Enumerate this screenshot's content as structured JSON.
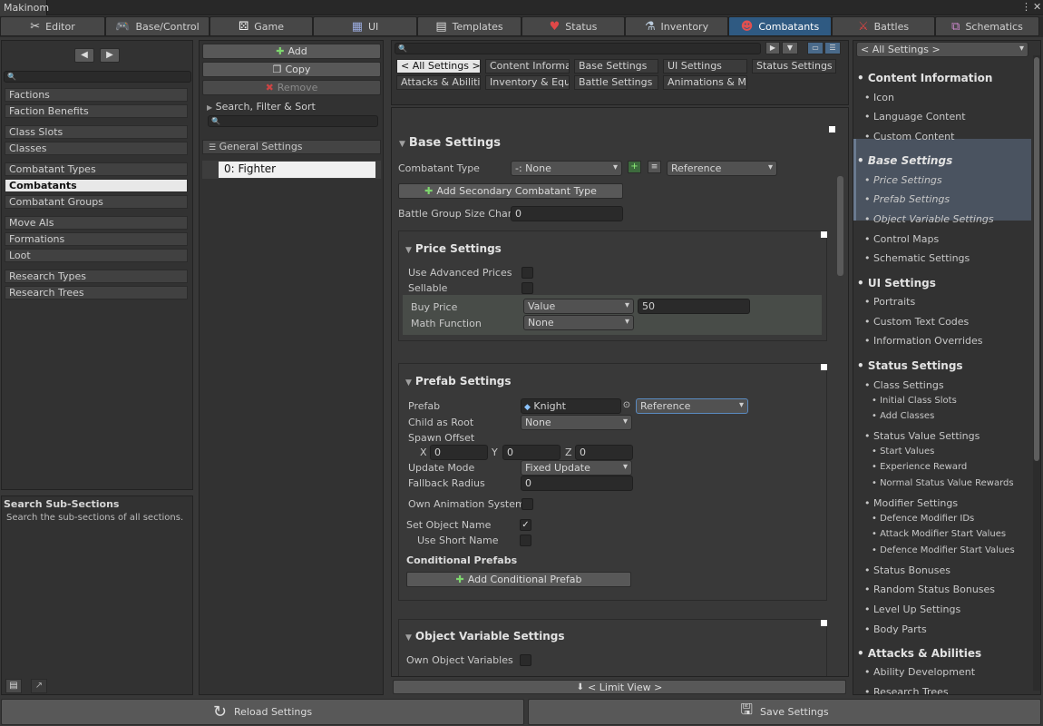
{
  "window": {
    "title": "Makinom"
  },
  "tabs": [
    {
      "label": "Editor",
      "icon": "tools-icon"
    },
    {
      "label": "Base/Control",
      "icon": "gamepad-icon"
    },
    {
      "label": "Game",
      "icon": "dice-icon"
    },
    {
      "label": "UI",
      "icon": "ui-window-icon"
    },
    {
      "label": "Templates",
      "icon": "document-icon"
    },
    {
      "label": "Status",
      "icon": "heart-icon"
    },
    {
      "label": "Inventory",
      "icon": "potion-icon"
    },
    {
      "label": "Combatants",
      "icon": "combatant-icon"
    },
    {
      "label": "Battles",
      "icon": "crossed-swords-icon"
    },
    {
      "label": "Schematics",
      "icon": "schematic-icon"
    }
  ],
  "active_tab": "Combatants",
  "left_nav": {
    "groups": [
      [
        "Factions",
        "Faction Benefits"
      ],
      [
        "Class Slots",
        "Classes"
      ],
      [
        "Combatant Types",
        "Combatants",
        "Combatant Groups"
      ],
      [
        "Move AIs",
        "Formations",
        "Loot"
      ],
      [
        "Research Types",
        "Research Trees"
      ]
    ],
    "active": "Combatants",
    "help_title": "Search Sub-Sections",
    "help_text": "Search the sub-sections of all sections."
  },
  "list_panel": {
    "add_label": "Add",
    "copy_label": "Copy",
    "remove_label": "Remove",
    "search_label": "Search, Filter & Sort",
    "general_settings_label": "General Settings",
    "items": [
      "0: Fighter"
    ]
  },
  "chips": {
    "row1": [
      "< All Settings >",
      "Content Informatic",
      "Base Settings",
      "UI Settings",
      "Status Settings"
    ],
    "row2": [
      "Attacks & Abilities",
      "Inventory & Equipr",
      "Battle Settings",
      "Animations & Mov"
    ]
  },
  "base_settings": {
    "title": "Base Settings",
    "combatant_type_label": "Combatant Type",
    "combatant_type_value": "-: None",
    "combatant_type_mode": "Reference",
    "add_secondary_label": "Add Secondary Combatant Type",
    "battle_group_label": "Battle Group Size Change",
    "battle_group_value": "0"
  },
  "price_settings": {
    "title": "Price Settings",
    "use_advanced_label": "Use Advanced Prices",
    "sellable_label": "Sellable",
    "buy_price_label": "Buy Price",
    "buy_price_type": "Value",
    "buy_price_value": "50",
    "math_function_label": "Math Function",
    "math_function_value": "None"
  },
  "prefab_settings": {
    "title": "Prefab Settings",
    "prefab_label": "Prefab",
    "prefab_value": "Knight",
    "prefab_mode": "Reference",
    "child_as_root_label": "Child as Root",
    "child_as_root_value": "None",
    "spawn_offset_label": "Spawn Offset",
    "x_label": "X",
    "x_value": "0",
    "y_label": "Y",
    "y_value": "0",
    "z_label": "Z",
    "z_value": "0",
    "update_mode_label": "Update Mode",
    "update_mode_value": "Fixed Update",
    "fallback_radius_label": "Fallback Radius",
    "fallback_radius_value": "0",
    "own_animation_label": "Own Animation System",
    "set_object_name_label": "Set Object Name",
    "use_short_name_label": "Use Short Name",
    "conditional_prefabs_label": "Conditional Prefabs",
    "add_conditional_label": "Add Conditional Prefab"
  },
  "object_variable_settings": {
    "title": "Object Variable Settings",
    "own_object_variables_label": "Own Object Variables"
  },
  "limit_view_label": "< Limit View >",
  "right_tree": {
    "dropdown": "< All Settings >",
    "items": [
      {
        "label": "Content Information",
        "level": "h"
      },
      {
        "label": "Icon",
        "level": "1"
      },
      {
        "label": "Language Content",
        "level": "1"
      },
      {
        "label": "Custom Content",
        "level": "1"
      },
      {
        "label": "Base Settings",
        "level": "h-active"
      },
      {
        "label": "Price Settings",
        "level": "1-active"
      },
      {
        "label": "Prefab Settings",
        "level": "1-active"
      },
      {
        "label": "Object Variable Settings",
        "level": "1-active"
      },
      {
        "label": "Control Maps",
        "level": "1"
      },
      {
        "label": "Schematic Settings",
        "level": "1"
      },
      {
        "label": "UI Settings",
        "level": "h"
      },
      {
        "label": "Portraits",
        "level": "1"
      },
      {
        "label": "Custom Text Codes",
        "level": "1"
      },
      {
        "label": "Information Overrides",
        "level": "1"
      },
      {
        "label": "Status Settings",
        "level": "h"
      },
      {
        "label": "Class Settings",
        "level": "1"
      },
      {
        "label": "Initial Class Slots",
        "level": "2"
      },
      {
        "label": "Add Classes",
        "level": "2"
      },
      {
        "label": "Status Value Settings",
        "level": "1"
      },
      {
        "label": "Start Values",
        "level": "2"
      },
      {
        "label": "Experience Reward",
        "level": "2"
      },
      {
        "label": "Normal Status Value Rewards",
        "level": "2"
      },
      {
        "label": "Modifier Settings",
        "level": "1"
      },
      {
        "label": "Defence Modifier IDs",
        "level": "2"
      },
      {
        "label": "Attack Modifier Start Values",
        "level": "2"
      },
      {
        "label": "Defence Modifier Start Values",
        "level": "2"
      },
      {
        "label": "Status Bonuses",
        "level": "1"
      },
      {
        "label": "Random Status Bonuses",
        "level": "1"
      },
      {
        "label": "Level Up Settings",
        "level": "1"
      },
      {
        "label": "Body Parts",
        "level": "1"
      },
      {
        "label": "Attacks & Abilities",
        "level": "h"
      },
      {
        "label": "Ability Development",
        "level": "1"
      },
      {
        "label": "Research Trees",
        "level": "1"
      }
    ]
  },
  "footer": {
    "reload_label": "Reload Settings",
    "save_label": "Save Settings"
  },
  "colors": {
    "active_tab": "#2f5a82",
    "tree_highlight": "#4a5360"
  }
}
